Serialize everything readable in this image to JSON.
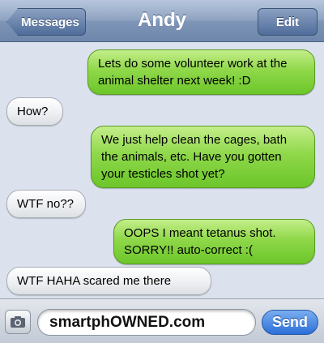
{
  "header": {
    "title": "Andy",
    "back_label": "Messages",
    "edit_label": "Edit"
  },
  "messages": [
    {
      "direction": "sent",
      "text": "Lets do some volunteer work at the animal shelter next week! :D"
    },
    {
      "direction": "received",
      "text": "How?"
    },
    {
      "direction": "sent",
      "text": "We just help clean the cages, bath the animals, etc. Have you gotten your testicles shot yet?"
    },
    {
      "direction": "received",
      "text": "WTF no??"
    },
    {
      "direction": "sent",
      "text": "OOPS I meant tetanus shot. SORRY!! auto-correct :("
    },
    {
      "direction": "received",
      "text": "WTF HAHA scared me there"
    }
  ],
  "composer": {
    "input_value": "smartphOWNED.com",
    "send_label": "Send",
    "camera_icon": "camera-icon"
  },
  "colors": {
    "sent_bubble": "#8fd84a",
    "received_bubble": "#eceef1",
    "background": "#dbe2ed",
    "send_button": "#2b6fd9"
  }
}
